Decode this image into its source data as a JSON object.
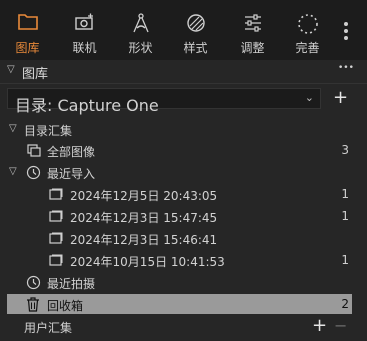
{
  "toolbar": {
    "tools": [
      {
        "label": "图库",
        "icon": "folder-icon",
        "active": true
      },
      {
        "label": "联机",
        "icon": "camera-icon",
        "active": false
      },
      {
        "label": "形状",
        "icon": "compass-icon",
        "active": false
      },
      {
        "label": "样式",
        "icon": "styles-icon",
        "active": false
      },
      {
        "label": "调整",
        "icon": "sliders-icon",
        "active": false
      },
      {
        "label": "完善",
        "icon": "dotted-circle-icon",
        "active": false
      }
    ],
    "accent_color": "#e98a3a"
  },
  "library": {
    "title": "图库",
    "more_label": "•••",
    "catalog_select": "目录: Capture One",
    "add_label": "+"
  },
  "tree": {
    "group_title": "目录汇集",
    "all_images": {
      "label": "全部图像",
      "count": "3"
    },
    "recent_imports": {
      "label": "最近导入"
    },
    "imports": [
      {
        "label": "2024年12月5日 20:43:05",
        "count": "1"
      },
      {
        "label": "2024年12月3日 15:47:45",
        "count": "1"
      },
      {
        "label": "2024年12月3日 15:46:41",
        "count": ""
      },
      {
        "label": "2024年10月15日 10:41:53",
        "count": "1"
      }
    ],
    "recent_captures": {
      "label": "最近拍摄"
    },
    "trash": {
      "label": "回收箱",
      "count": "2"
    }
  },
  "user_collections": {
    "title": "用户汇集",
    "add_label": "+",
    "remove_label": "−"
  }
}
